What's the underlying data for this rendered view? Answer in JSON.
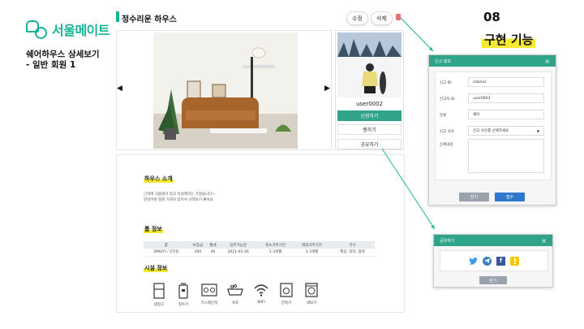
{
  "brand": {
    "name": "서울메이트"
  },
  "page_caption": "쉐어하우스 상세보기\n- 일반 회원 1",
  "feature": {
    "number": "08",
    "title": "구현 기능"
  },
  "house": {
    "title": "정수리운 하우스",
    "edit_label": "수정",
    "delete_label": "삭제",
    "prev_arrow": "◀",
    "next_arrow": "▶"
  },
  "profile": {
    "username": "user0002",
    "apply_label": "신청하기",
    "bookmark_label": "찜하기",
    "share_label": "공유하기"
  },
  "intro": {
    "heading": "하우스 소개",
    "text": "근처에 식물원이 있고 욕실액이는 가깝습니다~\n한강미원 정원 가까이 있어서 산책하기 좋아요"
  },
  "room_info": {
    "heading": "룸 정보",
    "columns": [
      "룸",
      "보증금",
      "월세",
      "입주가능일",
      "최소거주기간",
      "최대거주기간",
      "가구"
    ],
    "rows": [
      [
        "SM607 / 2인실",
        "300",
        "40",
        "2021-05-26",
        "1-3개월",
        "1-3개월",
        "책상, 의자, 침대"
      ]
    ]
  },
  "facilities": {
    "heading": "시설 정보",
    "items": [
      {
        "label": "냉장고",
        "icon": "fridge-icon"
      },
      {
        "label": "정수기",
        "icon": "water-purifier-icon"
      },
      {
        "label": "가스레인지",
        "icon": "gas-stove-icon"
      },
      {
        "label": "욕조",
        "icon": "bathtub-icon"
      },
      {
        "label": "WIFI",
        "icon": "wifi-icon"
      },
      {
        "label": "전자기",
        "icon": "microwave-icon"
      },
      {
        "label": "세탁기",
        "icon": "washer-icon"
      }
    ]
  },
  "report_modal": {
    "title": "신고 정보",
    "close": "×",
    "fields": [
      {
        "label": "신고 ID",
        "value": "ndamiz"
      },
      {
        "label": "신고자 ID",
        "value": "user0003"
      },
      {
        "label": "분류",
        "value": "쉐어"
      },
      {
        "label": "신고 사유",
        "value": "신고 사유를 선택하세요"
      },
      {
        "label": "상세내용",
        "value": ""
      }
    ],
    "cancel_label": "닫기",
    "submit_label": "접수"
  },
  "share_modal": {
    "title": "공유하기",
    "close": "×",
    "icons": [
      "twitter-icon",
      "telegram-icon",
      "facebook-icon",
      "kakao-icon"
    ],
    "close_label": "닫기"
  },
  "colors": {
    "brand": "#17b497",
    "primary_button": "#2fa488",
    "submit_button": "#2f78d0",
    "highlight": "#f5ea30"
  }
}
